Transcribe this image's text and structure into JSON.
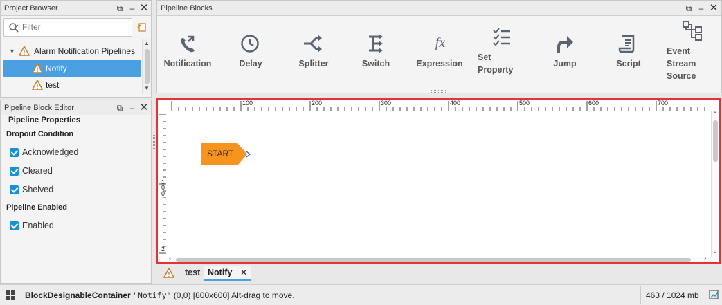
{
  "project_browser": {
    "title": "Project Browser",
    "filter_placeholder": "Filter",
    "tree": {
      "root": "Alarm Notification Pipelines",
      "items": [
        "Notify",
        "test"
      ]
    }
  },
  "pipeline_blocks": {
    "title": "Pipeline Blocks",
    "blocks": [
      {
        "label": "Notification",
        "icon": "phone-arrow-icon"
      },
      {
        "label": "Delay",
        "icon": "clock-icon"
      },
      {
        "label": "Splitter",
        "icon": "split-arrows-icon"
      },
      {
        "label": "Switch",
        "icon": "switch-icon"
      },
      {
        "label": "Expression",
        "icon": "fx-icon"
      },
      {
        "label": "Set Property",
        "icon": "checklist-icon"
      },
      {
        "label": "Jump",
        "icon": "jump-arrow-icon"
      },
      {
        "label": "Script",
        "icon": "script-icon"
      },
      {
        "label": "Event Stream Source",
        "icon": "network-icon"
      }
    ]
  },
  "block_editor": {
    "title": "Pipeline Block Editor",
    "tab": "Pipeline Properties",
    "dropout_title": "Dropout Condition",
    "dropout": [
      "Acknowledged",
      "Cleared",
      "Shelved"
    ],
    "enabled_title": "Pipeline Enabled",
    "enabled_label": "Enabled"
  },
  "canvas": {
    "start_label": "START",
    "ruler_x": [
      "100",
      "200",
      "300",
      "400",
      "500",
      "600",
      "700"
    ],
    "ruler_y": [
      "1",
      "0",
      "0",
      "2"
    ]
  },
  "tabs": {
    "items": [
      "test",
      "Notify"
    ]
  },
  "status": {
    "message_prefix": "BlockDesignableContainer ",
    "message_code": "\"Notify\"",
    "message_suffix": " (0,0) [800x600] Alt-drag to move.",
    "memory": "463 / 1024 mb"
  },
  "colors": {
    "accent": "#4a9fe0",
    "start_block": "#f7941d",
    "canvas_border": "#e53333",
    "checkbox": "#1a8fd1"
  }
}
